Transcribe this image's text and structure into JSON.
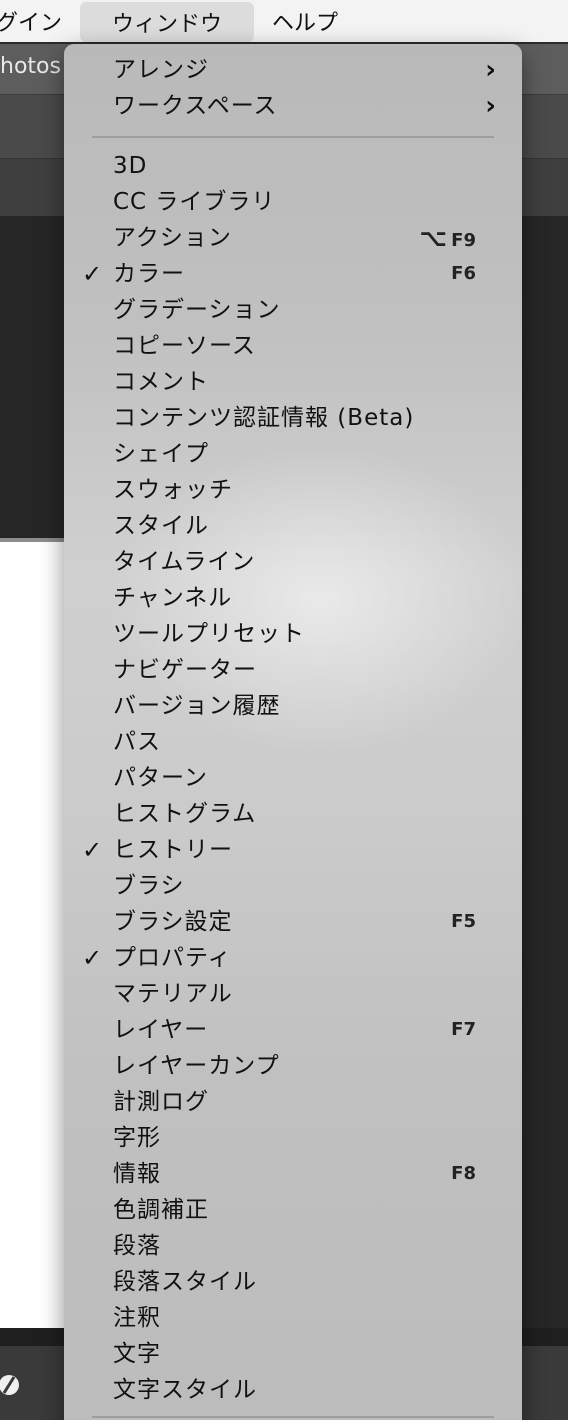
{
  "menubar": {
    "items": [
      {
        "label": "グイン"
      },
      {
        "label": "ウィンドウ"
      },
      {
        "label": "ヘルプ"
      }
    ]
  },
  "app": {
    "title_fragment": "hotos"
  },
  "menu": {
    "submenus": [
      {
        "label": "アレンジ",
        "icon": "chevron-right-icon"
      },
      {
        "label": "ワークスペース",
        "icon": "chevron-right-icon"
      }
    ],
    "items": [
      {
        "label": "3D",
        "checked": false,
        "shortcut": ""
      },
      {
        "label": "CC ライブラリ",
        "checked": false,
        "shortcut": ""
      },
      {
        "label": "アクション",
        "checked": false,
        "shortcut": "F9",
        "modifier": "⌥"
      },
      {
        "label": "カラー",
        "checked": true,
        "shortcut": "F6"
      },
      {
        "label": "グラデーション",
        "checked": false,
        "shortcut": ""
      },
      {
        "label": "コピーソース",
        "checked": false,
        "shortcut": ""
      },
      {
        "label": "コメント",
        "checked": false,
        "shortcut": ""
      },
      {
        "label": "コンテンツ認証情報 (Beta)",
        "checked": false,
        "shortcut": ""
      },
      {
        "label": "シェイプ",
        "checked": false,
        "shortcut": ""
      },
      {
        "label": "スウォッチ",
        "checked": false,
        "shortcut": ""
      },
      {
        "label": "スタイル",
        "checked": false,
        "shortcut": ""
      },
      {
        "label": "タイムライン",
        "checked": false,
        "shortcut": ""
      },
      {
        "label": "チャンネル",
        "checked": false,
        "shortcut": ""
      },
      {
        "label": "ツールプリセット",
        "checked": false,
        "shortcut": ""
      },
      {
        "label": "ナビゲーター",
        "checked": false,
        "shortcut": ""
      },
      {
        "label": "バージョン履歴",
        "checked": false,
        "shortcut": ""
      },
      {
        "label": "パス",
        "checked": false,
        "shortcut": ""
      },
      {
        "label": "パターン",
        "checked": false,
        "shortcut": ""
      },
      {
        "label": "ヒストグラム",
        "checked": false,
        "shortcut": ""
      },
      {
        "label": "ヒストリー",
        "checked": true,
        "shortcut": ""
      },
      {
        "label": "ブラシ",
        "checked": false,
        "shortcut": ""
      },
      {
        "label": "ブラシ設定",
        "checked": false,
        "shortcut": "F5"
      },
      {
        "label": "プロパティ",
        "checked": true,
        "shortcut": ""
      },
      {
        "label": "マテリアル",
        "checked": false,
        "shortcut": ""
      },
      {
        "label": "レイヤー",
        "checked": false,
        "shortcut": "F7"
      },
      {
        "label": "レイヤーカンプ",
        "checked": false,
        "shortcut": ""
      },
      {
        "label": "計測ログ",
        "checked": false,
        "shortcut": ""
      },
      {
        "label": "字形",
        "checked": false,
        "shortcut": ""
      },
      {
        "label": "情報",
        "checked": false,
        "shortcut": "F8"
      },
      {
        "label": "色調補正",
        "checked": false,
        "shortcut": ""
      },
      {
        "label": "段落",
        "checked": false,
        "shortcut": ""
      },
      {
        "label": "段落スタイル",
        "checked": false,
        "shortcut": ""
      },
      {
        "label": "注釈",
        "checked": false,
        "shortcut": ""
      },
      {
        "label": "文字",
        "checked": false,
        "shortcut": ""
      },
      {
        "label": "文字スタイル",
        "checked": false,
        "shortcut": ""
      }
    ],
    "check_glyph": "✓",
    "chevron_glyph": "›"
  }
}
